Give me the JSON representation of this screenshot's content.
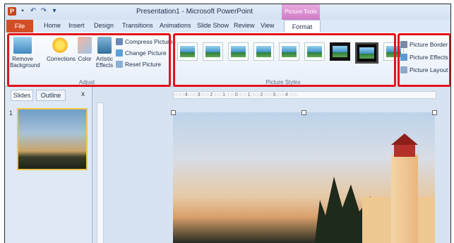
{
  "titlebar": {
    "title": "Presentation1 - Microsoft PowerPoint",
    "tools_label": "Picture Tools",
    "app_icon": "P",
    "min": "–",
    "max": "□",
    "close": "✕"
  },
  "tabs": [
    "File",
    "Home",
    "Insert",
    "Design",
    "Transitions",
    "Animations",
    "Slide Show",
    "Review",
    "View",
    "Format"
  ],
  "ribbon": {
    "adjust": {
      "label": "Adjust",
      "remove_background": "Remove Background",
      "corrections": "Corrections",
      "color": "Color",
      "artistic_effects": "Artistic Effects",
      "compress": "Compress Pictures",
      "change": "Change Picture",
      "reset": "Reset Picture"
    },
    "styles": {
      "label": "Picture Styles"
    },
    "right": {
      "border": "Picture Border",
      "effects": "Picture Effects",
      "layout": "Picture Layout"
    }
  },
  "pane": {
    "tab_slides": "Slides",
    "tab_outline": "Outline",
    "close": "x",
    "slide_number": "1"
  },
  "ruler": "·:·:·:4·:·:·3·:·:·2·:·:·1·:·:·0·:·:·1·:·:·2·:·:·3·:·:·4·:·:·",
  "colors": {
    "highlight": "#e0141e",
    "file_tab": "#d24e25",
    "tools_tab": "#d07bc5"
  }
}
